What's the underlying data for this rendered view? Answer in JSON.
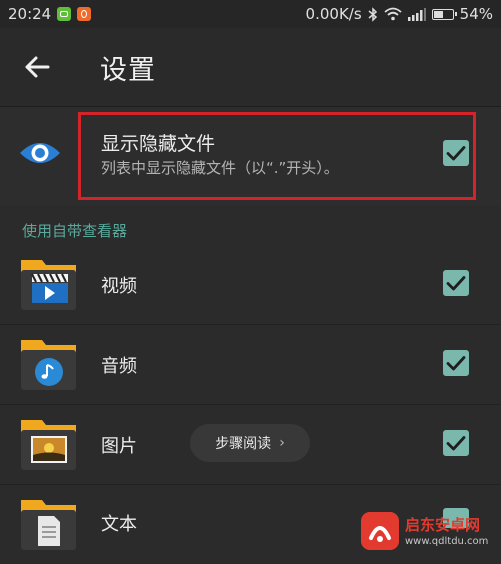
{
  "status_bar": {
    "time": "20:24",
    "network_speed": "0.00K/s",
    "battery_percent": "54%",
    "battery_level": 0.54
  },
  "header": {
    "title": "设置"
  },
  "hidden_files": {
    "title": "显示隐藏文件",
    "subtitle": "列表中显示隐藏文件（以“.”开头）。",
    "checked": true
  },
  "section": {
    "title": "使用自带查看器"
  },
  "viewers": [
    {
      "label": "视频",
      "checked": true
    },
    {
      "label": "音频",
      "checked": true
    },
    {
      "label": "图片",
      "checked": true
    },
    {
      "label": "文本",
      "checked": true
    }
  ],
  "reader_pill": {
    "label": "步骤阅读",
    "chevron": "›"
  },
  "watermark": {
    "name": "启东安卓网",
    "url": "www.qdltdu.com"
  },
  "colors": {
    "accent": "#5aa99c",
    "checkbox": "#7ab7ad",
    "highlight": "#d4242a",
    "folder": "#f0a81e"
  }
}
